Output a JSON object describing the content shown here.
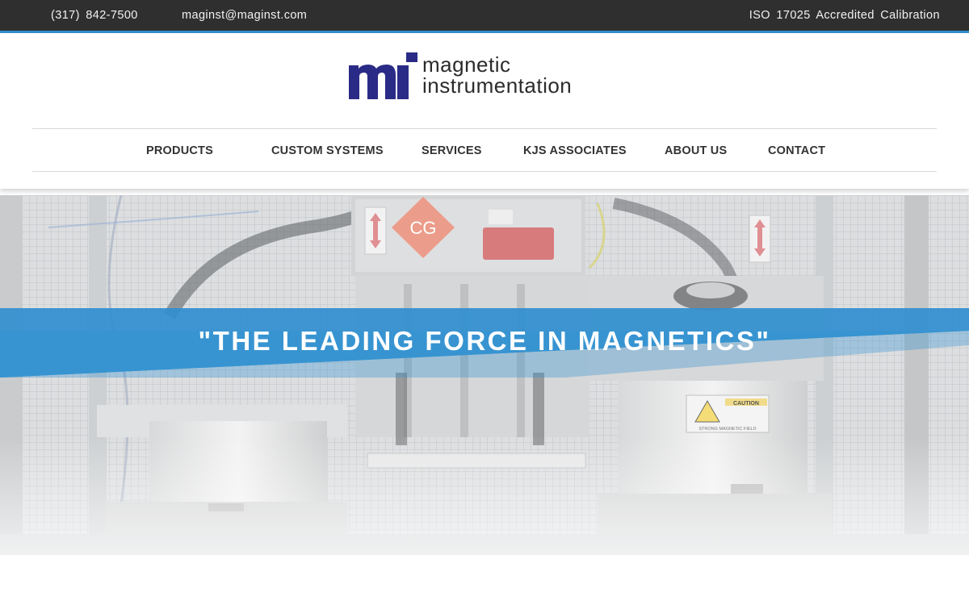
{
  "topbar": {
    "phone": "(317) 842-7500",
    "email": "maginst@maginst.com",
    "accreditation": "ISO 17025 Accredited Calibration"
  },
  "logo": {
    "line1": "magnetic",
    "line2": "instrumentation",
    "mark_color": "#2a2b86"
  },
  "nav": {
    "items": [
      {
        "label": "PRODUCTS"
      },
      {
        "label": "CUSTOM SYSTEMS"
      },
      {
        "label": "SERVICES"
      },
      {
        "label": "KJS ASSOCIATES"
      },
      {
        "label": "ABOUT US"
      },
      {
        "label": "CONTACT"
      }
    ]
  },
  "hero": {
    "tagline": "\"THE LEADING FORCE IN MAGNETICS\"",
    "sign_left": "CG",
    "caution_label": "CAUTION",
    "caution_sub": "STRONG MAGNETIC FIELD",
    "banner_color": "#3a96d1"
  },
  "colors": {
    "topbar_bg": "#2f2f2f",
    "accent": "#2e8fcf",
    "nav_text": "#333333"
  }
}
